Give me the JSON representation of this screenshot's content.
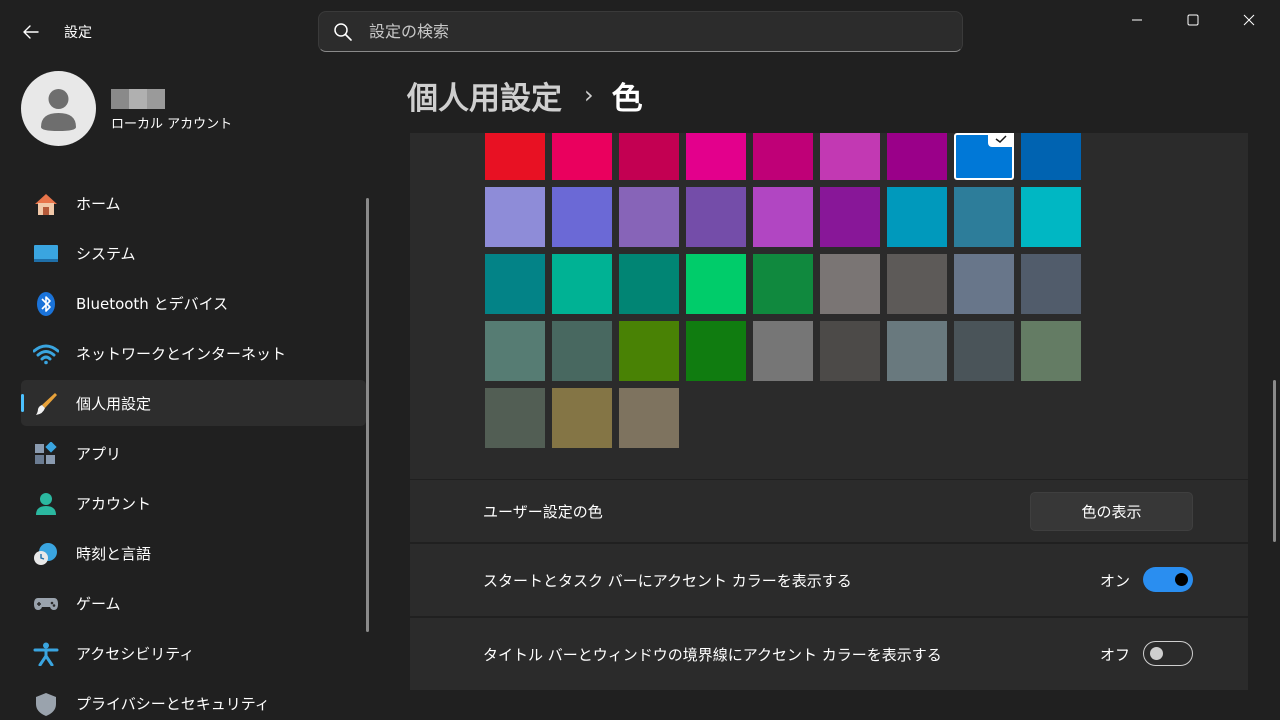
{
  "window": {
    "app_title": "設定",
    "back_icon": "back-arrow-icon",
    "minimize_icon": "minimize-icon",
    "maximize_icon": "maximize-icon",
    "close_icon": "close-icon"
  },
  "search": {
    "placeholder": "設定の検索",
    "value": ""
  },
  "profile": {
    "account_type": "ローカル アカウント"
  },
  "sidebar": {
    "items": [
      {
        "label": "ホーム",
        "icon": "home-icon",
        "active": false
      },
      {
        "label": "システム",
        "icon": "system-icon",
        "active": false
      },
      {
        "label": "Bluetooth とデバイス",
        "icon": "bluetooth-icon",
        "active": false
      },
      {
        "label": "ネットワークとインターネット",
        "icon": "wifi-icon",
        "active": false
      },
      {
        "label": "個人用設定",
        "icon": "brush-icon",
        "active": true
      },
      {
        "label": "アプリ",
        "icon": "apps-icon",
        "active": false
      },
      {
        "label": "アカウント",
        "icon": "account-icon",
        "active": false
      },
      {
        "label": "時刻と言語",
        "icon": "time-language-icon",
        "active": false
      },
      {
        "label": "ゲーム",
        "icon": "gamepad-icon",
        "active": false
      },
      {
        "label": "アクセシビリティ",
        "icon": "accessibility-icon",
        "active": false
      },
      {
        "label": "プライバシーとセキュリティ",
        "icon": "shield-icon",
        "active": false
      }
    ]
  },
  "breadcrumb": {
    "parent": "個人用設定",
    "separator": "›",
    "current": "色"
  },
  "accent_colors": {
    "rows": [
      [
        "#e81123",
        "#ea005e",
        "#c30052",
        "#e3008c",
        "#bf0077",
        "#c239b3",
        "#9a0089",
        "#0078d7",
        "#0063b1"
      ],
      [
        "#8e8cd8",
        "#6b69d6",
        "#8764b8",
        "#744da9",
        "#b146c2",
        "#881798",
        "#0099bc",
        "#2d7d9a",
        "#00b7c3"
      ],
      [
        "#038387",
        "#00b294",
        "#018574",
        "#00cc6a",
        "#10893e",
        "#7a7574",
        "#5d5a58",
        "#68768a",
        "#515c6b"
      ],
      [
        "#567c73",
        "#486860",
        "#498205",
        "#107c10",
        "#767676",
        "#4c4a48",
        "#69797e",
        "#4a5459",
        "#647c64"
      ],
      [
        "#525e54",
        "#847545",
        "#7e735f"
      ]
    ],
    "selected": "#0078d7"
  },
  "settings": {
    "custom_color": {
      "label": "ユーザー設定の色",
      "button_label": "色の表示"
    },
    "accent_start_taskbar": {
      "label": "スタートとタスク バーにアクセント カラーを表示する",
      "state_label": "オン",
      "on": true
    },
    "accent_titlebar_borders": {
      "label": "タイトル バーとウィンドウの境界線にアクセント カラーを表示する",
      "state_label": "オフ",
      "on": false
    }
  }
}
